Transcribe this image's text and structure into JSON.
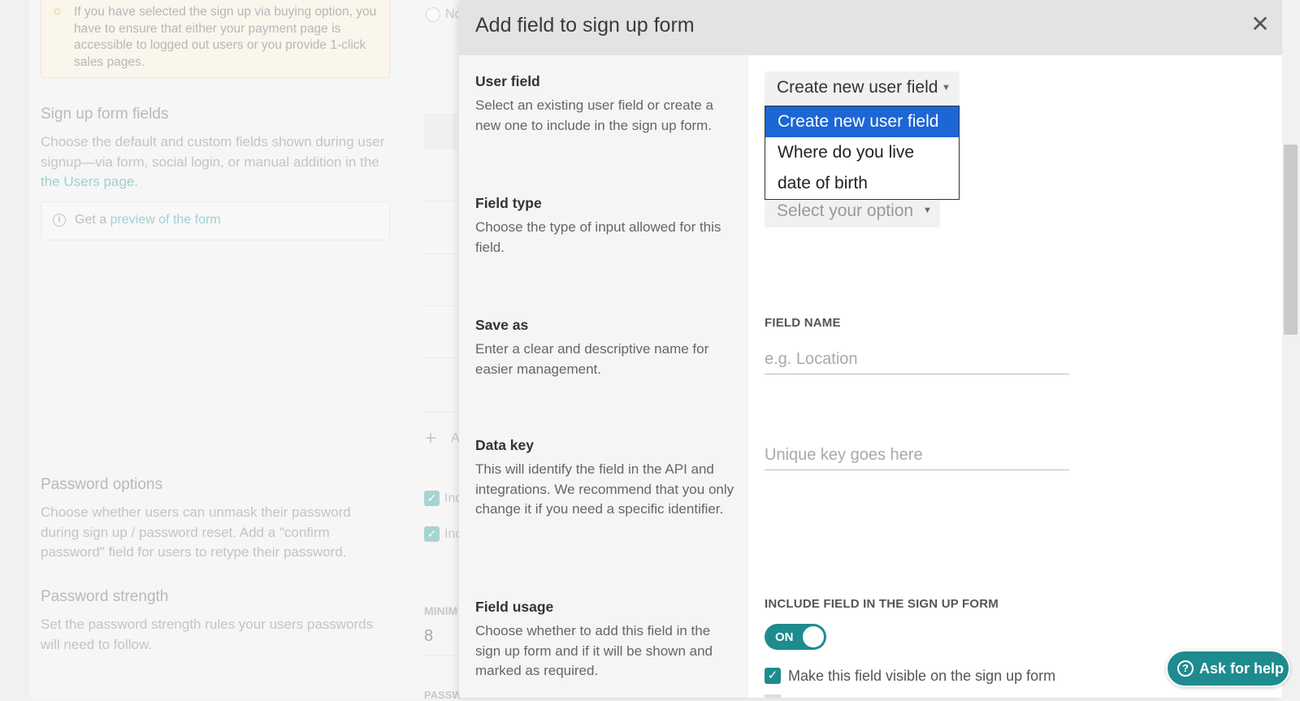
{
  "background": {
    "tip_text": "If you have selected the sign up via buying option, you have to ensure that either your payment page is accessible to logged out users or you provide 1-click sales pages.",
    "signup_fields_title": "Sign up form fields",
    "signup_fields_desc_prefix": "Choose the default and custom fields shown during user signup—via form, social login, or manual addition in the ",
    "signup_fields_desc_link": "the Users page",
    "signup_fields_desc_suffix": ".",
    "preview_prefix": "Get a ",
    "preview_link": "preview of the form",
    "password_options_title": "Password options",
    "password_options_desc": "Choose whether users can unmask their password during sign up / password reset. Add a \"confirm password\" field for users to retype their password.",
    "password_strength_title": "Password strength",
    "password_strength_desc": "Set the password strength rules your users passwords will need to follow.",
    "mid_radio_text": "No",
    "mid_add_text": "A",
    "mid_check1_text": "Inc",
    "mid_check2_text": "Inc",
    "mid_min_label": "MINIM",
    "mid_min_value": "8",
    "mid_pass_label": "PASSW"
  },
  "modal": {
    "title": "Add field to sign up form",
    "close_symbol": "✕",
    "user_field": {
      "label": "User field",
      "desc": "Select an existing user field or create a new one to include in the sign up form.",
      "selected": "Create new user field",
      "options": [
        "Create new user field",
        "Where do you live",
        "date of birth"
      ]
    },
    "field_type": {
      "label": "Field type",
      "desc": "Choose the type of input allowed for this field.",
      "placeholder": "Select your option"
    },
    "save_as": {
      "label": "Save as",
      "desc": "Enter a clear and descriptive name for easier management.",
      "input_label": "FIELD NAME",
      "placeholder": "e.g. Location"
    },
    "data_key": {
      "label": "Data key",
      "desc": "This will identify the field in the API and integrations. We recommend that you only change it if you need a specific identifier.",
      "placeholder": "Unique key goes here"
    },
    "field_usage": {
      "label": "Field usage",
      "desc": "Choose whether to add this field in the sign up form and if it will be shown and marked as required.",
      "include_label": "INCLUDE FIELD IN THE SIGN UP FORM",
      "toggle_text": "ON",
      "visible_label": "Make this field visible on the sign up form"
    }
  },
  "help": {
    "label": "Ask for help"
  },
  "colors": {
    "accent": "#1e8b8f",
    "dropdown_selected": "#1c66d5"
  }
}
